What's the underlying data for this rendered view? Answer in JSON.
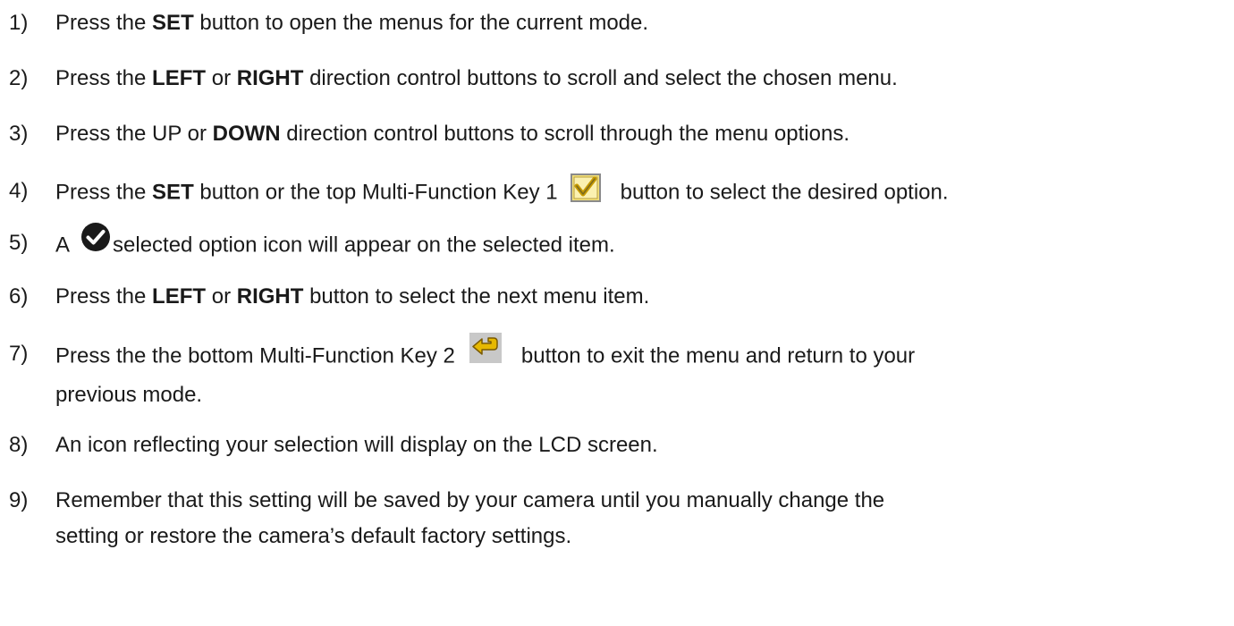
{
  "steps": [
    {
      "number": "1)",
      "parts": [
        "Press the ",
        "SET",
        " button to open the menus for the current mode."
      ]
    },
    {
      "number": "2)",
      "parts": [
        "Press the ",
        "LEFT",
        " or ",
        "RIGHT",
        " direction control buttons to scroll and select the chosen menu."
      ]
    },
    {
      "number": "3)",
      "parts": [
        "Press the UP or ",
        "DOWN",
        " direction control buttons to scroll through the menu options."
      ]
    },
    {
      "number": "4)",
      "parts": [
        "Press the ",
        "SET",
        " button or the top Multi-Function Key 1",
        "button to select the desired option."
      ],
      "icon": "checkbox-check-icon"
    },
    {
      "number": "5)",
      "parts": [
        "A",
        "selected option icon will appear on the selected item."
      ],
      "icon": "selected-option-check-icon"
    },
    {
      "number": "6)",
      "parts": [
        "Press the ",
        "LEFT",
        " or ",
        "RIGHT",
        " button to select the next menu item."
      ]
    },
    {
      "number": "7)",
      "parts": [
        "Press the the bottom Multi-Function Key 2",
        "button to exit the menu and return to your",
        "previous mode."
      ],
      "icon": "return-arrow-icon"
    },
    {
      "number": "8)",
      "parts": [
        "An icon reflecting your selection will display on the LCD screen."
      ]
    },
    {
      "number": "9)",
      "parts": [
        "Remember that this setting will be saved by your camera until you manually change the",
        "setting or restore the camera’s default factory settings."
      ]
    }
  ],
  "colors": {
    "text": "#1a1a1a",
    "checkbox_fill": "#f5e27a",
    "checkbox_check": "#c79a00",
    "return_arrow": "#e6b800"
  }
}
